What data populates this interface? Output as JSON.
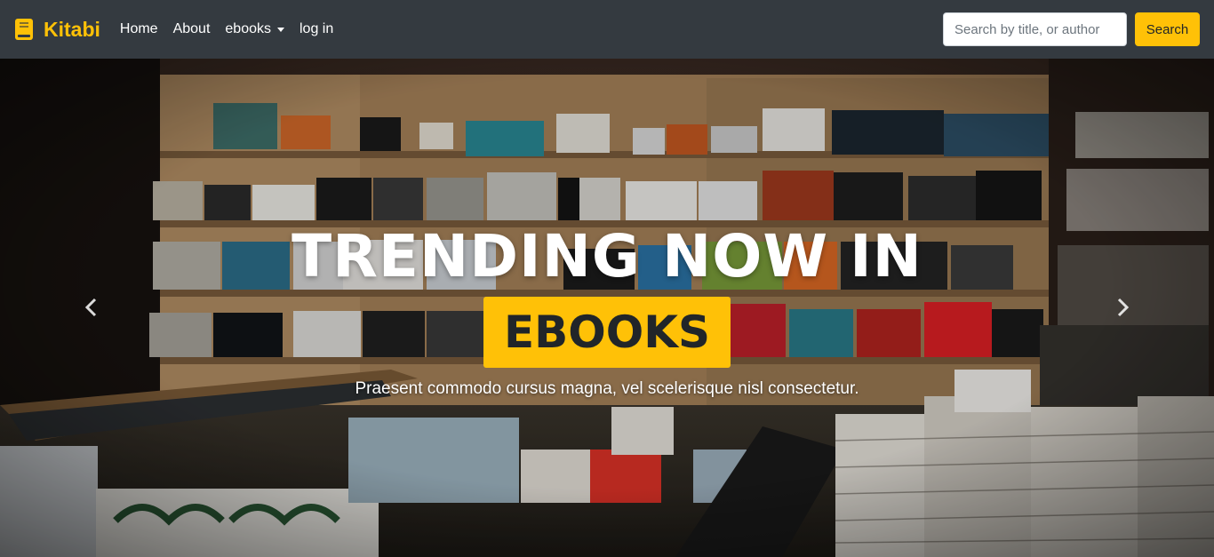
{
  "brand": {
    "name": "Kitabi",
    "icon": "book-icon",
    "color": "#ffc107"
  },
  "nav": {
    "items": [
      {
        "label": "Home"
      },
      {
        "label": "About"
      },
      {
        "label": "ebooks"
      },
      {
        "label": "log in"
      }
    ]
  },
  "search": {
    "placeholder": "Search by title, or author",
    "button_label": "Search"
  },
  "hero": {
    "title": "TRENDING NOW IN",
    "badge": "EBOOKS",
    "text": "Praesent commodo cursus magna, vel scelerisque nisl consectetur.",
    "prev_icon": "chevron-left-icon",
    "next_icon": "chevron-right-icon"
  },
  "colors": {
    "navbar": "#343a40",
    "accent": "#ffc107",
    "text": "#ffffff"
  }
}
